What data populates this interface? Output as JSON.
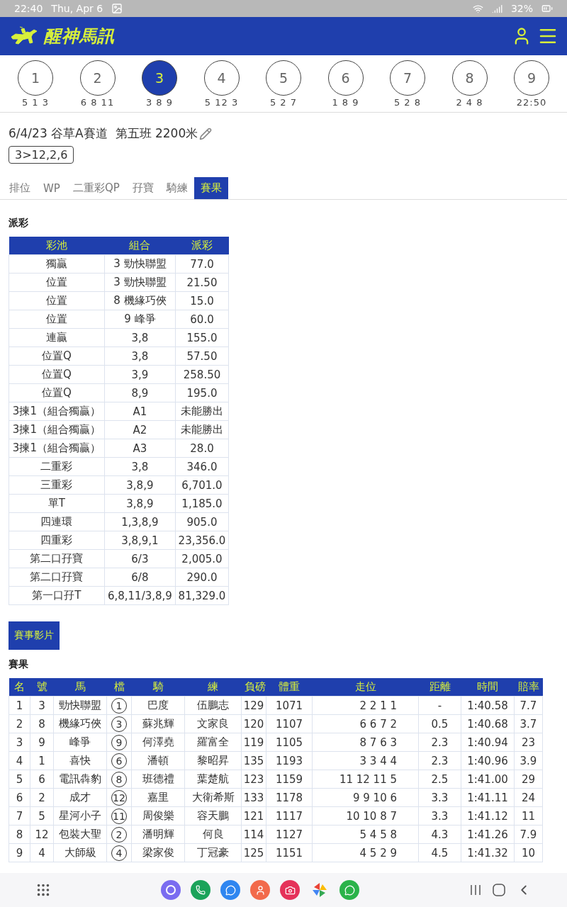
{
  "status_bar": {
    "time": "22:40",
    "date": "Thu, Apr 6",
    "battery": "32%"
  },
  "header": {
    "title": "醒神馬訊"
  },
  "races": [
    {
      "number": "1",
      "result": "5 1 3",
      "selected": false
    },
    {
      "number": "2",
      "result": "6 8 11",
      "selected": false
    },
    {
      "number": "3",
      "result": "3 8 9",
      "selected": true
    },
    {
      "number": "4",
      "result": "5 12 3",
      "selected": false
    },
    {
      "number": "5",
      "result": "5 2 7",
      "selected": false
    },
    {
      "number": "6",
      "result": "1 8 9",
      "selected": false
    },
    {
      "number": "7",
      "result": "5 2 8",
      "selected": false
    },
    {
      "number": "8",
      "result": "2 4 8",
      "selected": false
    },
    {
      "number": "9",
      "result": "22:50",
      "selected": false
    }
  ],
  "race_info": {
    "title": "6/4/23 谷草A賽道  第五班 2200米",
    "result_badge": "3>12,2,6"
  },
  "tabs": [
    {
      "label": "排位",
      "selected": false
    },
    {
      "label": "WP",
      "selected": false
    },
    {
      "label": "二重彩QP",
      "selected": false
    },
    {
      "label": "孖寶",
      "selected": false
    },
    {
      "label": "騎練",
      "selected": false
    },
    {
      "label": "賽果",
      "selected": true
    }
  ],
  "dividends": {
    "title": "派彩",
    "columns": [
      "彩池",
      "組合",
      "派彩"
    ],
    "rows": [
      [
        "獨贏",
        "3 勁快聯盟",
        "77.0"
      ],
      [
        "位置",
        "3 勁快聯盟",
        "21.50"
      ],
      [
        "位置",
        "8 機緣巧俠",
        "15.0"
      ],
      [
        "位置",
        "9 峰爭",
        "60.0"
      ],
      [
        "連贏",
        "3,8",
        "155.0"
      ],
      [
        "位置Q",
        "3,8",
        "57.50"
      ],
      [
        "位置Q",
        "3,9",
        "258.50"
      ],
      [
        "位置Q",
        "8,9",
        "195.0"
      ],
      [
        "3揀1（組合獨贏）",
        "A1",
        "未能勝出"
      ],
      [
        "3揀1（組合獨贏）",
        "A2",
        "未能勝出"
      ],
      [
        "3揀1（組合獨贏）",
        "A3",
        "28.0"
      ],
      [
        "二重彩",
        "3,8",
        "346.0"
      ],
      [
        "三重彩",
        "3,8,9",
        "6,701.0"
      ],
      [
        "單T",
        "3,8,9",
        "1,185.0"
      ],
      [
        "四連環",
        "1,3,8,9",
        "905.0"
      ],
      [
        "四重彩",
        "3,8,9,1",
        "23,356.0"
      ],
      [
        "第二口孖寶",
        "6/3",
        "2,005.0"
      ],
      [
        "第二口孖寶",
        "6/8",
        "290.0"
      ],
      [
        "第一口孖T",
        "6,8,11/3,8,9",
        "81,329.0"
      ]
    ]
  },
  "video_button": {
    "label": "賽事影片"
  },
  "results": {
    "title": "賽果",
    "columns": [
      {
        "label": "名",
        "kind": "text"
      },
      {
        "label": "號",
        "kind": "text"
      },
      {
        "label": "馬",
        "kind": "text"
      },
      {
        "label": "檔",
        "kind": "draw"
      },
      {
        "label": "騎",
        "kind": "text"
      },
      {
        "label": "練",
        "kind": "text"
      },
      {
        "label": "負磅",
        "kind": "text"
      },
      {
        "label": "體重",
        "kind": "text"
      },
      {
        "label": "走位",
        "kind": "positions"
      },
      {
        "label": "距離",
        "kind": "text"
      },
      {
        "label": "時間",
        "kind": "text"
      },
      {
        "label": "賠率",
        "kind": "text"
      }
    ],
    "rows": [
      [
        "1",
        "3",
        "勁快聯盟",
        "1",
        "巴度",
        "伍鵬志",
        "129",
        "1071",
        "2 2 1 1",
        "-",
        "1:40.58",
        "7.7"
      ],
      [
        "2",
        "8",
        "機緣巧俠",
        "3",
        "蘇兆輝",
        "文家良",
        "120",
        "1107",
        "6 6 7 2",
        "0.5",
        "1:40.68",
        "3.7"
      ],
      [
        "3",
        "9",
        "峰爭",
        "9",
        "何澤堯",
        "羅富全",
        "119",
        "1105",
        "8 7 6 3",
        "2.3",
        "1:40.94",
        "23"
      ],
      [
        "4",
        "1",
        "喜快",
        "6",
        "潘頓",
        "黎昭昇",
        "135",
        "1193",
        "3 3 4 4",
        "2.3",
        "1:40.96",
        "3.9"
      ],
      [
        "5",
        "6",
        "電訊犇豹",
        "8",
        "班德禮",
        "葉楚航",
        "123",
        "1159",
        "11 12 11 5",
        "2.5",
        "1:41.00",
        "29"
      ],
      [
        "6",
        "2",
        "成才",
        "12",
        "嘉里",
        "大衛希斯",
        "133",
        "1178",
        "9 9 10 6",
        "3.3",
        "1:41.11",
        "24"
      ],
      [
        "7",
        "5",
        "星河小子",
        "11",
        "周俊樂",
        "容天鵬",
        "121",
        "1117",
        "10 10 8 7",
        "3.3",
        "1:41.12",
        "11"
      ],
      [
        "8",
        "12",
        "包裝大聖",
        "2",
        "潘明輝",
        "何良",
        "114",
        "1127",
        "5 4 5 8",
        "4.3",
        "1:41.26",
        "7.9"
      ],
      [
        "9",
        "4",
        "大師級",
        "4",
        "梁家俊",
        "丁冠豪",
        "125",
        "1151",
        "4 5 2 9",
        "4.5",
        "1:41.32",
        "10"
      ]
    ]
  }
}
